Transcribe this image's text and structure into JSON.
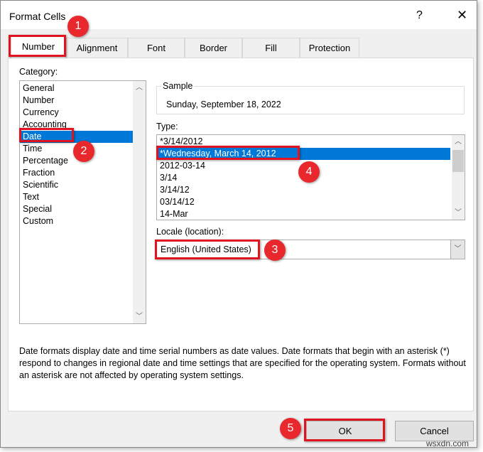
{
  "dialog": {
    "title": "Format Cells",
    "help": "?",
    "close": "✕"
  },
  "tabs": [
    {
      "label": "Number"
    },
    {
      "label": "Alignment"
    },
    {
      "label": "Font"
    },
    {
      "label": "Border"
    },
    {
      "label": "Fill"
    },
    {
      "label": "Protection"
    }
  ],
  "category": {
    "label": "Category:",
    "items": [
      "General",
      "Number",
      "Currency",
      "Accounting",
      "Date",
      "Time",
      "Percentage",
      "Fraction",
      "Scientific",
      "Text",
      "Special",
      "Custom"
    ],
    "selected": "Date"
  },
  "sample": {
    "label": "Sample",
    "value": "Sunday, September 18, 2022"
  },
  "type": {
    "label": "Type:",
    "items": [
      "*3/14/2012",
      "*Wednesday, March 14, 2012",
      "2012-03-14",
      "3/14",
      "3/14/12",
      "03/14/12",
      "14-Mar"
    ],
    "selected": "*Wednesday, March 14, 2012"
  },
  "locale": {
    "label": "Locale (location):",
    "value": "English (United States)"
  },
  "description": "Date formats display date and time serial numbers as date values.  Date formats that begin with an asterisk (*) respond to changes in regional date and time settings that are specified for the operating system. Formats without an asterisk are not affected by operating system settings.",
  "buttons": {
    "ok": "OK",
    "cancel": "Cancel"
  },
  "badges": [
    "1",
    "2",
    "3",
    "4",
    "5"
  ],
  "watermark": "wsxdn.com",
  "colors": {
    "selection": "#0078d7",
    "highlight": "#e0141e",
    "badge": "#e8282d"
  }
}
